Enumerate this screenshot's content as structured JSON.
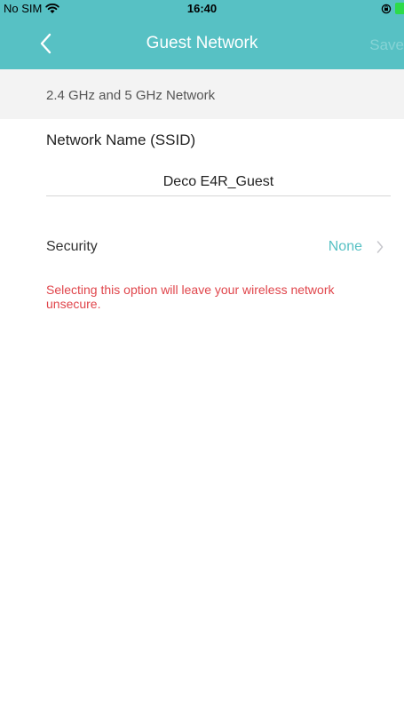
{
  "status_bar": {
    "carrier": "No SIM",
    "time": "16:40"
  },
  "nav": {
    "title": "Guest Network",
    "back_icon": "chevron-left-icon",
    "save_label": "Save"
  },
  "section": {
    "header": "2.4 GHz and 5 GHz Network"
  },
  "ssid": {
    "label": "Network Name (SSID)",
    "value": "Deco E4R_Guest"
  },
  "security": {
    "label": "Security",
    "value": "None",
    "warning": "Selecting this option will leave your wireless network unsecure."
  },
  "colors": {
    "accent": "#57c1c4",
    "warning": "#e0454b",
    "section_background": "#f3f3f3"
  }
}
